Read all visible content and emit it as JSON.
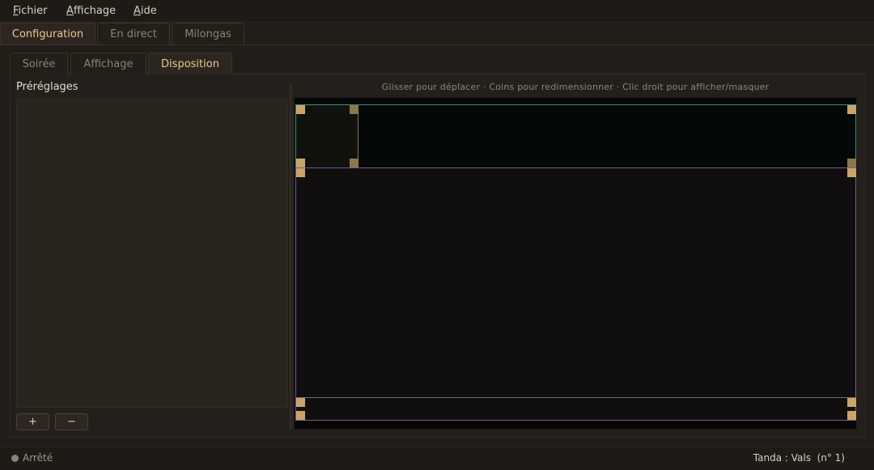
{
  "menubar": {
    "items": [
      {
        "mnemonic": "F",
        "rest": "ichier"
      },
      {
        "mnemonic": "A",
        "rest": "ffichage"
      },
      {
        "mnemonic": "A",
        "rest": "ide"
      }
    ]
  },
  "tabs": [
    "Configuration",
    "En direct",
    "Milongas"
  ],
  "subtabs": [
    "Soirée",
    "Affichage",
    "Disposition"
  ],
  "presets": {
    "title": "Préréglages",
    "add_label": "+",
    "remove_label": "−"
  },
  "layout_editor": {
    "hint": "Glisser pour déplacer · Coins pour redimensionner · Clic droit pour afficher/masquer",
    "zone_colors": {
      "header": "#3f8a84",
      "logo": "#a08a5a",
      "main": "#7f5a8c",
      "footer": "#5a7a5c",
      "handle": "#c9a46a"
    }
  },
  "status": {
    "state": "Arrêté",
    "tanda": "Tanda : Vals  (n° 1)"
  }
}
